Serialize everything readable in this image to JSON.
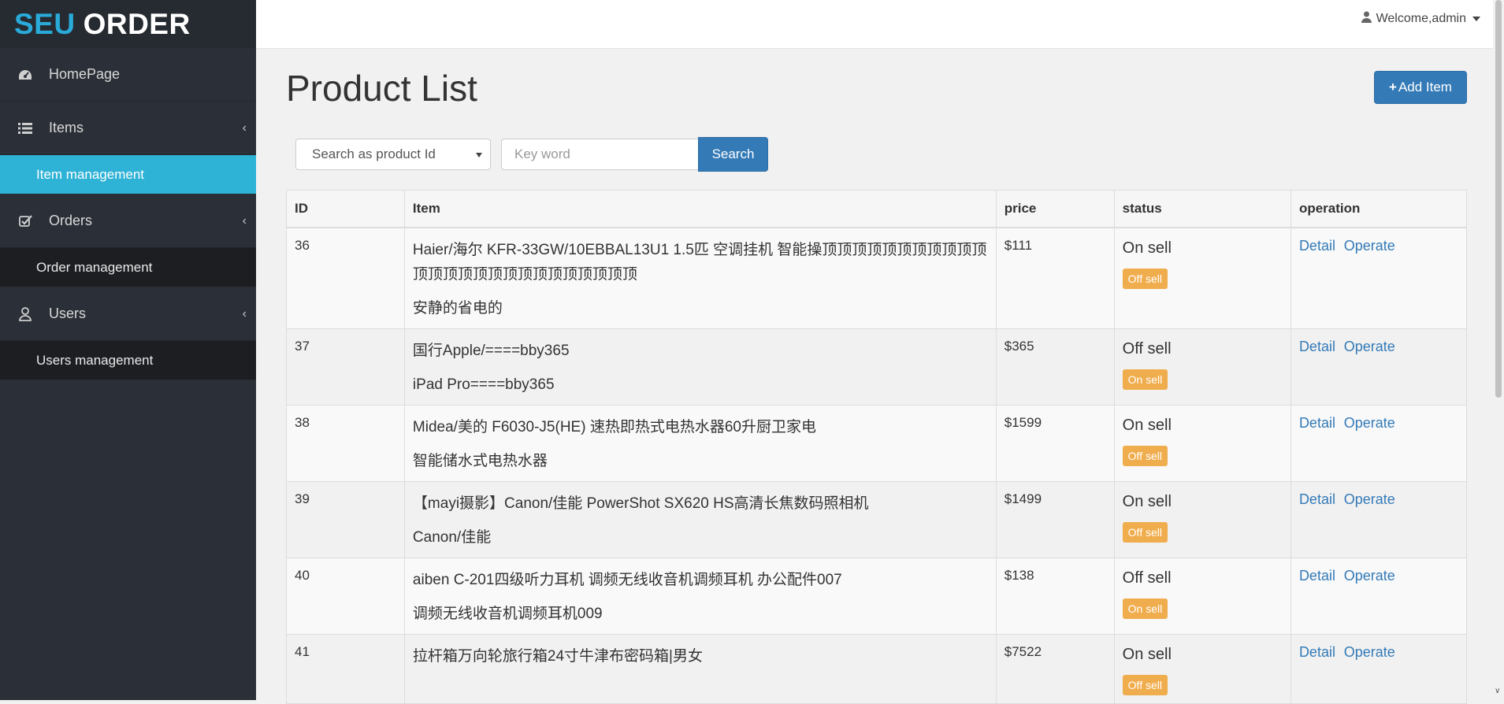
{
  "logo": {
    "part1": "SEU",
    "part2": "ORDER"
  },
  "sidebar": {
    "items": [
      {
        "label": "HomePage"
      },
      {
        "label": "Items"
      },
      {
        "label": "Orders"
      },
      {
        "label": "Users"
      }
    ],
    "subitems": {
      "items": "Item management",
      "orders": "Order management",
      "users": "Users management"
    }
  },
  "topbar": {
    "welcome": "Welcome,admin"
  },
  "page": {
    "title": "Product List",
    "add_button": "Add Item"
  },
  "search": {
    "select_value": "Search as product Id",
    "keyword_placeholder": "Key word",
    "button": "Search"
  },
  "table": {
    "headers": [
      "ID",
      "Item",
      "price",
      "status",
      "operation"
    ],
    "rows": [
      {
        "id": "36",
        "name": "Haier/海尔 KFR-33GW/10EBBAL13U1 1.5匹 空调挂机 智能操顶顶顶顶顶顶顶顶顶顶顶顶顶顶顶顶顶顶顶顶顶顶顶顶顶顶",
        "desc": "安静的省电的",
        "price": "$111",
        "status": "On sell",
        "toggle": "Off sell"
      },
      {
        "id": "37",
        "name": "国行Apple/====bby365",
        "desc": "iPad Pro====bby365",
        "price": "$365",
        "status": "Off sell",
        "toggle": "On sell"
      },
      {
        "id": "38",
        "name": "Midea/美的 F6030-J5(HE) 速热即热式电热水器60升厨卫家电",
        "desc": "智能储水式电热水器",
        "price": "$1599",
        "status": "On sell",
        "toggle": "Off sell"
      },
      {
        "id": "39",
        "name": "【mayi摄影】Canon/佳能 PowerShot SX620 HS高清长焦数码照相机",
        "desc": "Canon/佳能",
        "price": "$1499",
        "status": "On sell",
        "toggle": "Off sell"
      },
      {
        "id": "40",
        "name": "aiben C-201四级听力耳机 调频无线收音机调频耳机 办公配件007",
        "desc": "调频无线收音机调频耳机009",
        "price": "$138",
        "status": "Off sell",
        "toggle": "On sell"
      },
      {
        "id": "41",
        "name": "拉杆箱万向轮旅行箱24寸牛津布密码箱|男女",
        "desc": "",
        "price": "$7522",
        "status": "On sell",
        "toggle": "Off sell"
      }
    ],
    "operations": {
      "detail": "Detail",
      "operate": "Operate"
    }
  },
  "colors": {
    "sidebar_bg": "#2b2f37",
    "accent": "#2eb2d6",
    "primary": "#337ab7",
    "badge": "#f0ad4e"
  }
}
